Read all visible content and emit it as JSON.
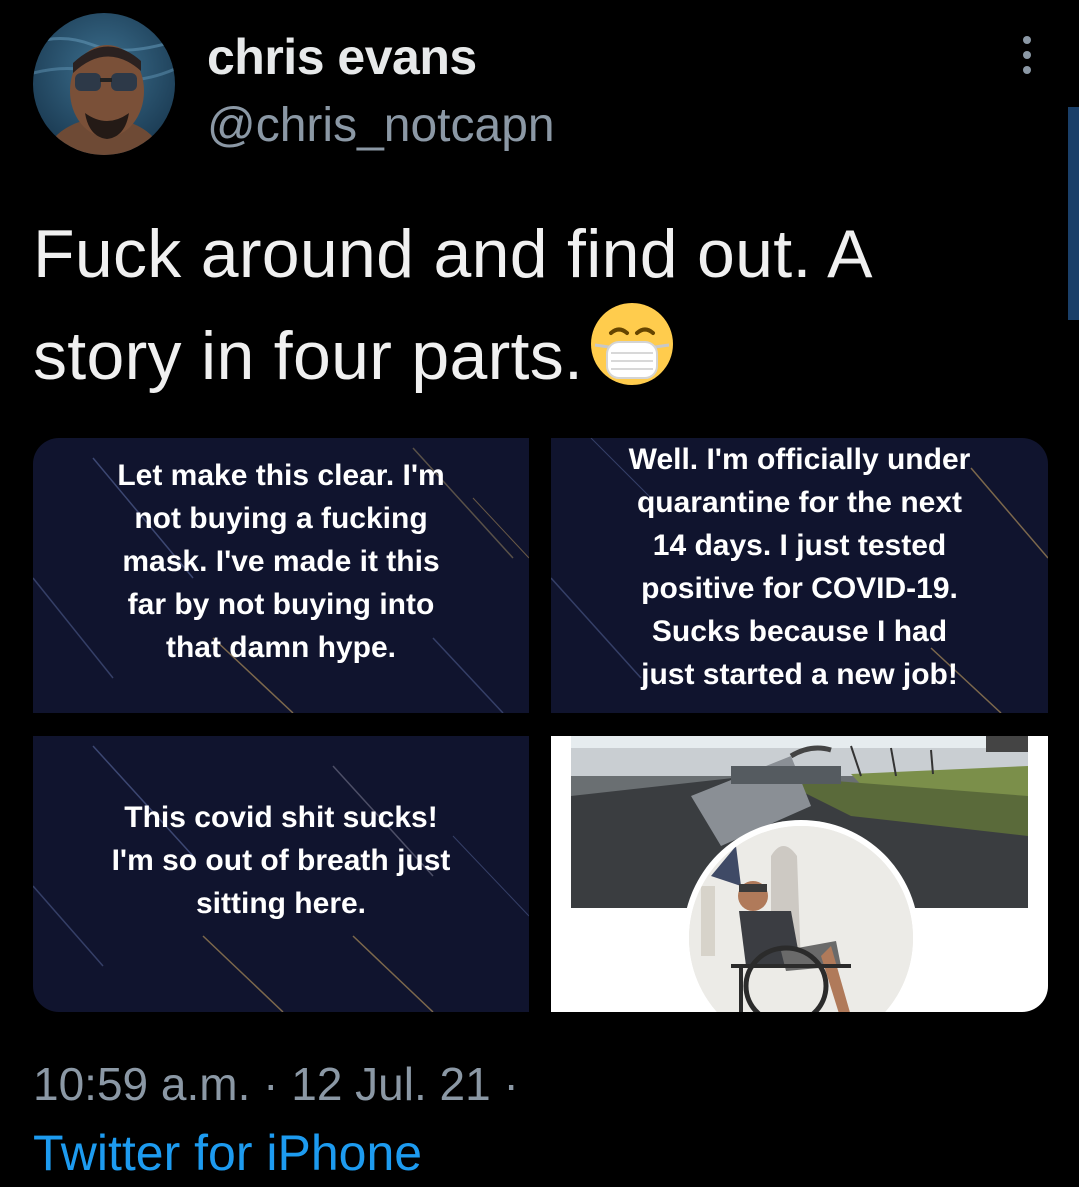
{
  "author": {
    "display_name": "chris evans",
    "handle": "@chris_notcapn"
  },
  "tweet": {
    "line1": "Fuck around and find out. A",
    "line2": "story in four parts.",
    "emoji": "face-with-medical-mask"
  },
  "media": {
    "panel1": {
      "lines": [
        "Let make this clear. I'm",
        "not buying a fucking",
        "mask. I've made it this",
        "far by not buying into",
        "that damn hype."
      ]
    },
    "panel2": {
      "lines": [
        "Well. I'm officially under",
        "quarantine for the next",
        "14 days. I just tested",
        "positive for COVID-19.",
        "Sucks because I had",
        "just started a new job!"
      ]
    },
    "panel3": {
      "lines": [
        "This covid shit sucks!",
        "I'm so out of breath just",
        "sitting here."
      ]
    },
    "panel4": {
      "description_icon": "racetrack-photo-with-profile-avatar"
    }
  },
  "meta": {
    "timestamp": "10:59 a.m. · 12 Jul. 21 ·",
    "source": "Twitter for iPhone"
  },
  "colors": {
    "background": "#000000",
    "text": "#e7e9ea",
    "muted": "#8b98a5",
    "link": "#1d9bf0",
    "panel_bg": "#10142e"
  }
}
